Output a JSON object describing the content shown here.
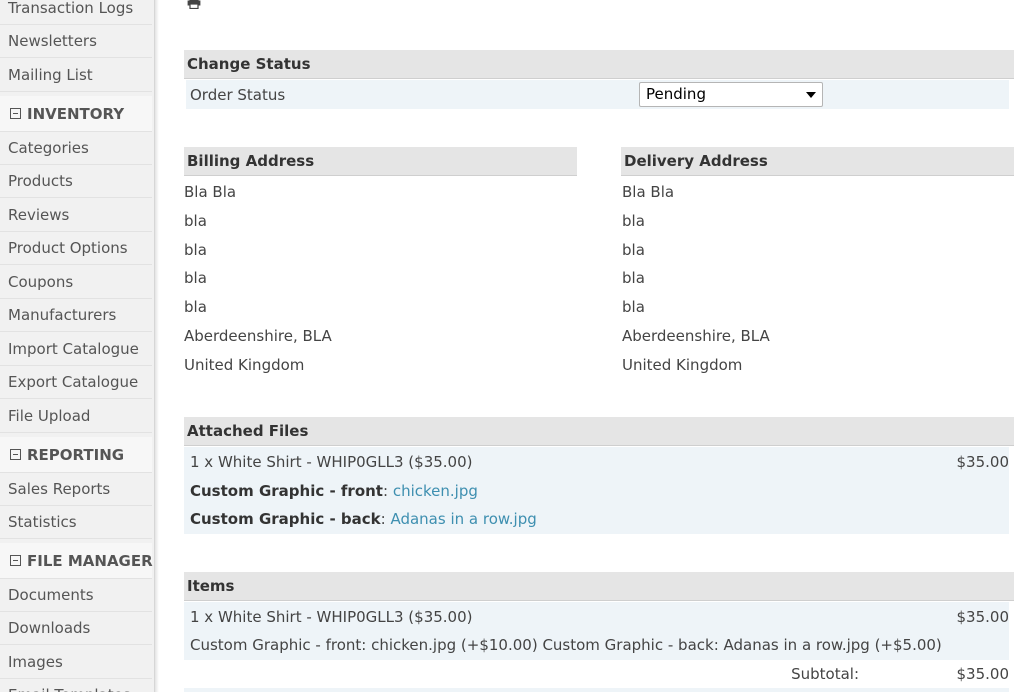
{
  "sidebar": {
    "items_top": [
      "Transaction Logs",
      "Newsletters",
      "Mailing List"
    ],
    "inventory": {
      "label": "INVENTORY",
      "items": [
        "Categories",
        "Products",
        "Reviews",
        "Product Options",
        "Coupons",
        "Manufacturers",
        "Import Catalogue",
        "Export Catalogue",
        "File Upload"
      ]
    },
    "reporting": {
      "label": "REPORTING",
      "items": [
        "Sales Reports",
        "Statistics"
      ]
    },
    "file_manager": {
      "label": "FILE MANAGER",
      "items": [
        "Documents",
        "Downloads",
        "Images",
        "Email Templates"
      ]
    }
  },
  "change_status": {
    "title": "Change Status",
    "label": "Order Status",
    "value": "Pending"
  },
  "billing": {
    "title": "Billing Address",
    "lines": [
      "Bla Bla",
      "bla",
      "bla",
      "bla",
      "bla",
      "Aberdeenshire, BLA",
      "United Kingdom"
    ]
  },
  "delivery": {
    "title": "Delivery Address",
    "lines": [
      "Bla Bla",
      "bla",
      "bla",
      "bla",
      "bla",
      "Aberdeenshire, BLA",
      "United Kingdom"
    ]
  },
  "attached_files": {
    "title": "Attached Files",
    "product": "1 x White Shirt - WHIP0GLL3 ($35.00)",
    "price": "$35.00",
    "front_label": "Custom Graphic - front",
    "front_file": "chicken.jpg",
    "back_label": "Custom Graphic - back",
    "back_file": "Adanas in a row.jpg",
    "separator": ":"
  },
  "items": {
    "title": "Items",
    "product": "1 x White Shirt - WHIP0GLL3 ($35.00)",
    "price": "$35.00",
    "options": "Custom Graphic - front: chicken.jpg (+$10.00) Custom Graphic - back: Adanas in a row.jpg (+$5.00)",
    "subtotal_label": "Subtotal:",
    "subtotal_value": "$35.00"
  },
  "icons": {
    "print": "printer-icon",
    "collapse": "minus-box-icon",
    "dropdown": "caret-down-icon"
  }
}
